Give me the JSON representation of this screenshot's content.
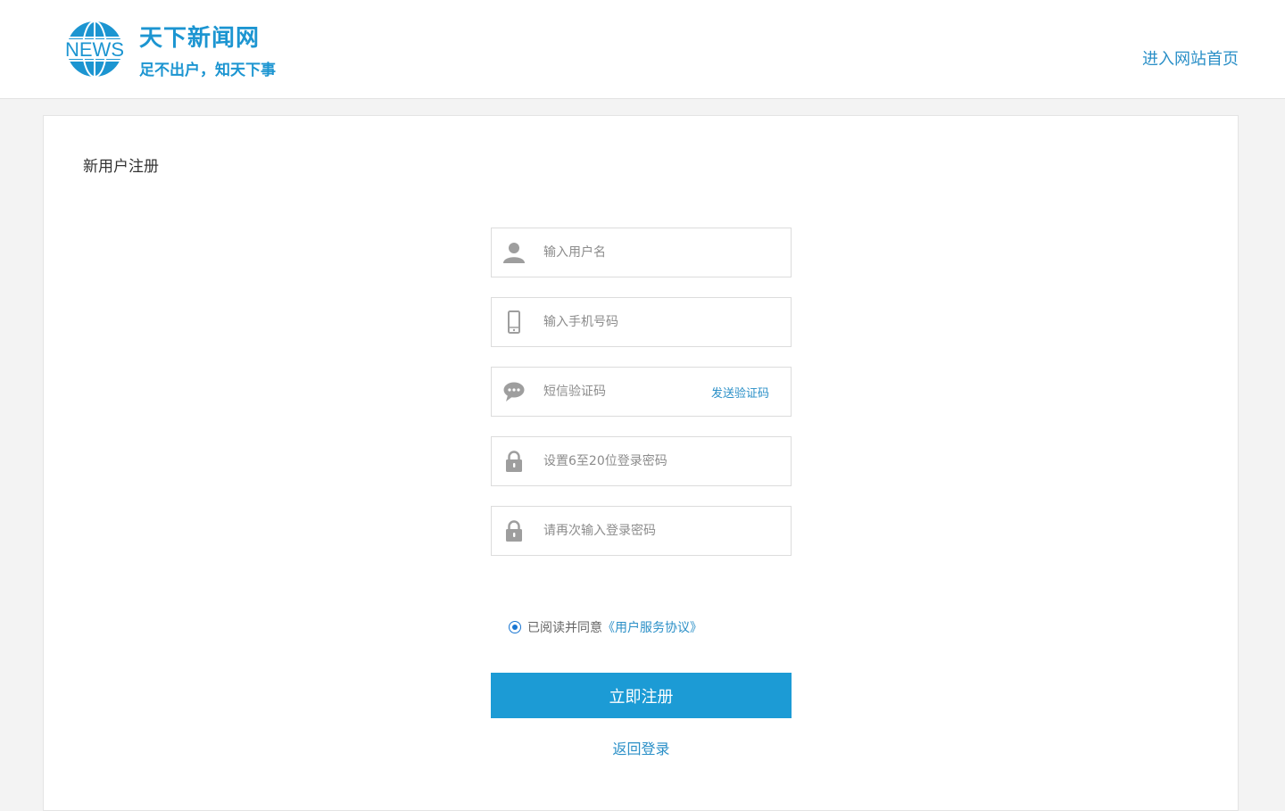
{
  "header": {
    "logo_text": "NEWS",
    "site_name": "天下新闻网",
    "slogan": "足不出户，知天下事",
    "home_link": "进入网站首页"
  },
  "register": {
    "title": "新用户注册",
    "fields": {
      "username": {
        "placeholder": "输入用户名",
        "icon": "user-icon"
      },
      "phone": {
        "placeholder": "输入手机号码",
        "icon": "phone-icon"
      },
      "sms_code": {
        "placeholder": "短信验证码",
        "icon": "chat-icon",
        "action": "发送验证码"
      },
      "password": {
        "placeholder": "设置6至20位登录密码",
        "icon": "lock-icon"
      },
      "confirm_password": {
        "placeholder": "请再次输入登录密码",
        "icon": "lock-icon"
      }
    },
    "agreement": {
      "checked": true,
      "prefix": "已阅读并同意",
      "link": "《用户服务协议》"
    },
    "submit_label": "立即注册",
    "back_login": "返回登录"
  },
  "colors": {
    "brand": "#1c95d1",
    "button": "#1c9bd5",
    "link": "#2a8fc7",
    "icon": "#9e9e9e"
  }
}
